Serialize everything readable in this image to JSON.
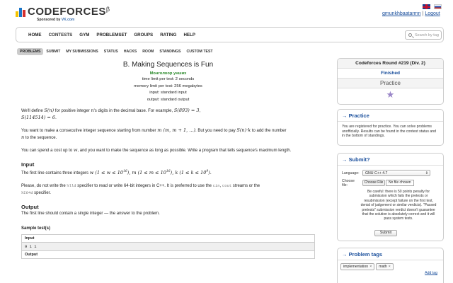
{
  "header": {
    "logo_text": "CODEFORCES",
    "logo_beta": "β",
    "sponsor_prefix": "Sponsored by ",
    "sponsor_name": "VK.com",
    "username": "gmunkhbaatarmn",
    "separator": "|",
    "logout": "Logout",
    "logo_colors": [
      "#f5c400",
      "#1a75c8",
      "#d32f2f"
    ]
  },
  "mainnav": {
    "items": [
      "HOME",
      "CONTESTS",
      "GYM",
      "PROBLEMSET",
      "GROUPS",
      "RATING",
      "HELP"
    ],
    "search_placeholder": "Search by tag"
  },
  "subnav": {
    "items": [
      "PROBLEMS",
      "SUBMIT",
      "MY SUBMISSIONS",
      "STATUS",
      "HACKS",
      "ROOM",
      "STANDINGS",
      "CUSTOM TEST"
    ]
  },
  "problem": {
    "title": "B. Making Sequences is Fun",
    "subtitle": "Монголоор унших",
    "time_limit": "time limit per test: 2 seconds",
    "memory_limit": "memory limit per test: 256 megabytes",
    "input": "input: standard input",
    "output": "output: standard output",
    "p1a": "We'll define ",
    "p1b": "S(n)",
    "p1c": " for positive integer ",
    "p1d": "n",
    "p1e": " as follows: the number of the digits in ",
    "p1f": "n",
    "p1g": "'s digits in the decimal base. For example, ",
    "p1h": "S(893) = 3",
    "p1i": ",",
    "p1j": "S(114514) = 6",
    "p1k": ".",
    "p2a": "You want to make a consecutive integer sequence starting from number ",
    "p2b": "m (m, m + 1, ...)",
    "p2c": ". But you need to pay ",
    "p2d": "S(n)·k",
    "p2e": " to add the number ",
    "p2f": "n",
    "p2g": " to the sequence.",
    "p3a": "You can spend a cost up to ",
    "p3b": "w",
    "p3c": ", and you want to make the sequence as long as possible. Write a program that tells sequence's maximum length.",
    "input_title": "Input",
    "input_a": "The first line contains three integers ",
    "input_b": "w (1 ≤ w ≤ 10",
    "input_b_sup": "16",
    "input_c": "), m (1 ≤ m ≤ 10",
    "input_c_sup": "16",
    "input_d": "), k (1 ≤ k ≤ 10",
    "input_d_sup": "9",
    "input_e": ").",
    "note_a": "Please, do not write the ",
    "note_b": "%lld",
    "note_c": " specifier to read or write 64-bit integers in C++. It is preferred to use the ",
    "note_d": "cin",
    "note_e": ", ",
    "note_f": "cout",
    "note_g": " streams or the",
    "note_h": "%I64d",
    "note_i": " specifier.",
    "output_title": "Output",
    "output_text": "The first line should contain a single integer — the answer to the problem.",
    "sample_label": "Sample test(s)",
    "sample_input_head": "Input",
    "sample_input_data": "9 1 1",
    "sample_output_head": "Output"
  },
  "sidebar": {
    "round_title": "Codeforces Round #219 (Div. 2)",
    "round_status": "Finished",
    "round_practice": "Practice",
    "practice_title": "→ Practice",
    "practice_text": "You are registered for practice. You can solve problems unofficially. Results can be found in the contest status and in the bottom of standings.",
    "submit_title": "→ Submit?",
    "language_label": "Language:",
    "language_value": "GNU C++ 4.7",
    "file_label_1": "Choose",
    "file_label_2": "file:",
    "file_button": "Choose File",
    "file_chosen": "No file chosen",
    "warning": "Be careful: there is 50 points penalty for submission which fails the pretests or resubmission (except failure on the first test, denial of judgement or similar verdicts). \"Passed pretests\" submission verdict doesn't guarantee that the solution is absolutely correct and it will pass system tests.",
    "submit_button": "Submit",
    "tags_title": "→ Problem tags",
    "tags": [
      "implementation",
      "math"
    ],
    "tag_close": "×",
    "add_tag": "Add tag"
  }
}
